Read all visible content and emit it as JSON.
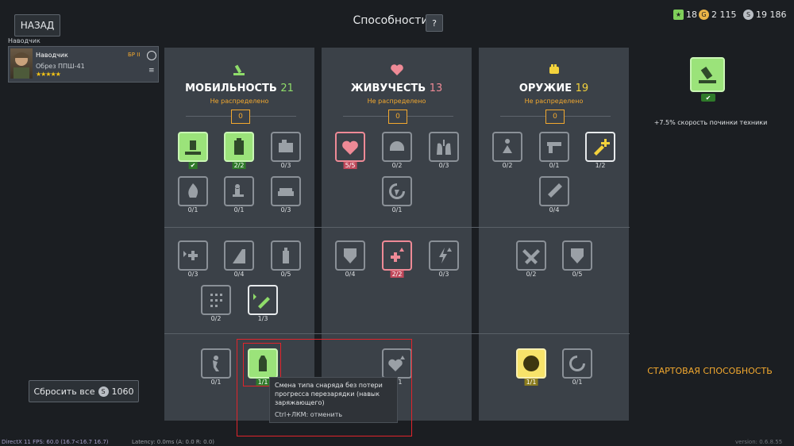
{
  "header": {
    "back_label": "НАЗАД",
    "title": "Способности",
    "help_label": "?"
  },
  "currencies": [
    {
      "name": "star-icon",
      "value": "18",
      "color": "#7fcf5a"
    },
    {
      "name": "gold-coin-icon",
      "value": "2 115",
      "color": "#e9b347"
    },
    {
      "name": "silver-coin-icon",
      "value": "19 186",
      "color": "#b9bec4"
    }
  ],
  "crew": {
    "section_label": "Наводчик",
    "name": "Наводчик",
    "br": "БР II",
    "weapon": "Обрез ППШ-41",
    "stars": "★★★★★",
    "menu_icon": "≡"
  },
  "panels": [
    {
      "key": "mobility",
      "title": "МОБИЛЬНОСТЬ",
      "points": "21",
      "points_color": "#8fdc6a",
      "icon_color": "#8fdc6a",
      "unassigned_label": "Не распределено",
      "unassigned_value": "0"
    },
    {
      "key": "survivability",
      "title": "ЖИВУЧЕСТЬ",
      "points": "13",
      "points_color": "#ee8a96",
      "icon_color": "#ee8a96",
      "unassigned_label": "Не распределено",
      "unassigned_value": "0"
    },
    {
      "key": "weapons",
      "title": "ОРУЖИЕ",
      "points": "19",
      "points_color": "#f3d23c",
      "icon_color": "#f3d23c",
      "unassigned_label": "Не распределено",
      "unassigned_value": "0"
    }
  ],
  "skills": {
    "mobility": [
      {
        "name": "repair-hammer-skill",
        "count": "",
        "state": "active",
        "icon": "hammer"
      },
      {
        "name": "backpack-skill",
        "count": "2/2",
        "state": "active",
        "icon": "backpack"
      },
      {
        "name": "engine-skill",
        "count": "0/3",
        "state": "",
        "icon": "engine"
      },
      {
        "name": "fire-skill",
        "count": "0/1",
        "state": "",
        "icon": "fire"
      },
      {
        "name": "seated-operator-skill",
        "count": "0/1",
        "state": "",
        "icon": "person-seat"
      },
      {
        "name": "tank-tread-skill",
        "count": "0/3",
        "state": "",
        "icon": "tread"
      },
      {
        "name": "medkit-speed-skill",
        "count": "0/3",
        "state": "",
        "icon": "medkit-fast"
      },
      {
        "name": "climb-skill",
        "count": "0/4",
        "state": "",
        "icon": "climb"
      },
      {
        "name": "extinguisher-skill",
        "count": "0/5",
        "state": "",
        "icon": "extinguisher"
      },
      {
        "name": "gearbox-skill",
        "count": "0/2",
        "state": "",
        "icon": "gearbox"
      },
      {
        "name": "fast-repair-skill",
        "count": "1/3",
        "state": "white",
        "icon": "wrench-fast"
      },
      {
        "name": "sprint-skill",
        "count": "0/1",
        "state": "",
        "icon": "sprint"
      },
      {
        "name": "shell-swap-skill",
        "count": "1/1",
        "state": "active",
        "icon": "shell"
      }
    ],
    "survivability": [
      {
        "name": "heart-regen-skill",
        "count": "5/5",
        "state": "red",
        "icon": "heart-regen"
      },
      {
        "name": "helmet-skill",
        "count": "0/2",
        "state": "",
        "icon": "helmet"
      },
      {
        "name": "lungs-skill",
        "count": "0/3",
        "state": "",
        "icon": "lungs"
      },
      {
        "name": "auto-regen-skill",
        "count": "0/1",
        "state": "",
        "icon": "regen"
      },
      {
        "name": "armor-shield-skill",
        "count": "0/4",
        "state": "",
        "icon": "shield"
      },
      {
        "name": "medkit-boost-skill",
        "count": "2/2",
        "state": "red",
        "icon": "medkit-up"
      },
      {
        "name": "energy-boost-skill",
        "count": "0/3",
        "state": "",
        "icon": "bolt-up"
      },
      {
        "name": "heart-boost-skill",
        "count": "0/1",
        "state": "",
        "icon": "heart-up"
      }
    ],
    "weapons": [
      {
        "name": "melee-run-skill",
        "count": "0/2",
        "state": "",
        "icon": "melee"
      },
      {
        "name": "pistol-skill",
        "count": "0/1",
        "state": "",
        "icon": "pistol"
      },
      {
        "name": "repair-kit-skill",
        "count": "1/2",
        "state": "white-yellow",
        "icon": "wrench-plus"
      },
      {
        "name": "knife-skill",
        "count": "0/4",
        "state": "",
        "icon": "knife"
      },
      {
        "name": "tools-skill",
        "count": "0/2",
        "state": "",
        "icon": "tools"
      },
      {
        "name": "medic-shield-skill",
        "count": "0/5",
        "state": "",
        "icon": "shield-plus"
      },
      {
        "name": "target-skill",
        "count": "1/1",
        "state": "yellow",
        "icon": "target"
      },
      {
        "name": "reload-skill",
        "count": "0/1",
        "state": "",
        "icon": "reload"
      }
    ]
  },
  "tooltip": {
    "text": "Смена типа снаряда без потери прогресса перезарядки (навык заряжающего)",
    "hint": "Ctrl+ЛКМ: отменить"
  },
  "reset": {
    "label": "Сбросить все",
    "cost": "1060"
  },
  "preview": {
    "desc": "+7.5% скорость починки техники",
    "check": "✔"
  },
  "start_skill_label": "СТАРТОВАЯ СПОСОБНОСТЬ",
  "footer": {
    "fps": "DirectX 11 FPS: 60.0 (16.7<16.7 16.7)",
    "latency": "Latency:  0.0ms (A:  0.0 R:  0.0)",
    "version": "version:  0.6.8.55"
  }
}
